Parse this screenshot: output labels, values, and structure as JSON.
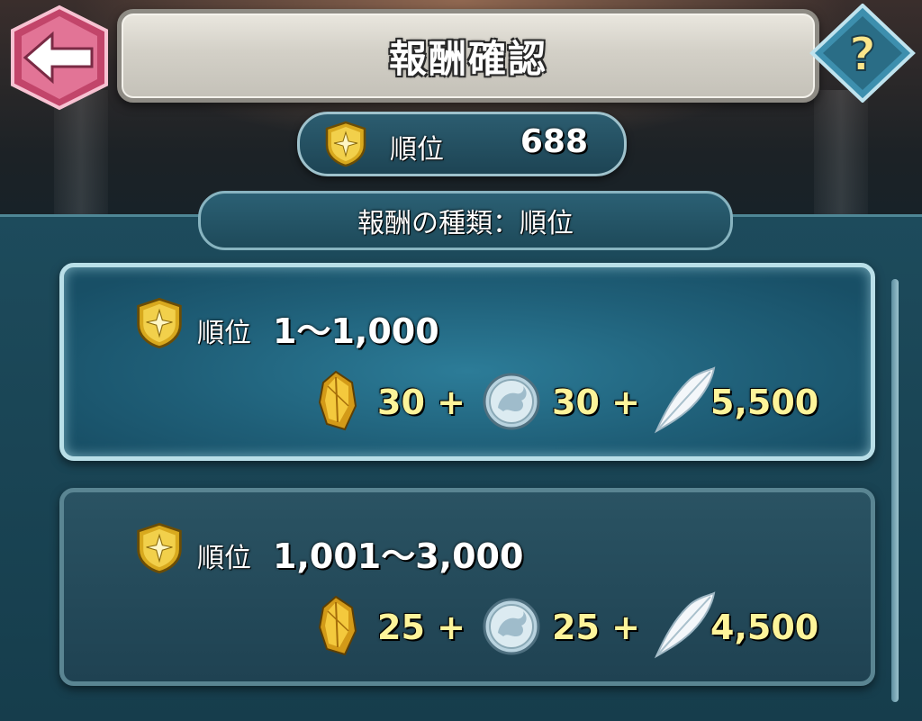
{
  "header": {
    "title": "報酬確認",
    "back_icon": "arrow-left-icon",
    "help_label": "?"
  },
  "rank": {
    "label": "順位",
    "value": "688",
    "icon": "rank-medal-icon"
  },
  "reward_type": {
    "label": "報酬の種類：順位"
  },
  "tiers": [
    {
      "label": "順位",
      "range": "1～1,000",
      "rewards": [
        {
          "icon": "orb-crystal-icon",
          "amount": "30 +"
        },
        {
          "icon": "silver-coin-icon",
          "amount": "30 +"
        },
        {
          "icon": "feather-icon",
          "amount": "5,500"
        }
      ],
      "state": "highlighted"
    },
    {
      "label": "順位",
      "range": "1,001～3,000",
      "rewards": [
        {
          "icon": "orb-crystal-icon",
          "amount": "25 +"
        },
        {
          "icon": "silver-coin-icon",
          "amount": "25 +"
        },
        {
          "icon": "feather-icon",
          "amount": "4,500"
        }
      ],
      "state": "normal"
    }
  ],
  "colors": {
    "accent_gold": "#fdf49a",
    "panel_teal": "#1d4b5c",
    "back_button": "#e06a8a",
    "help_button": "#2a6d86"
  }
}
